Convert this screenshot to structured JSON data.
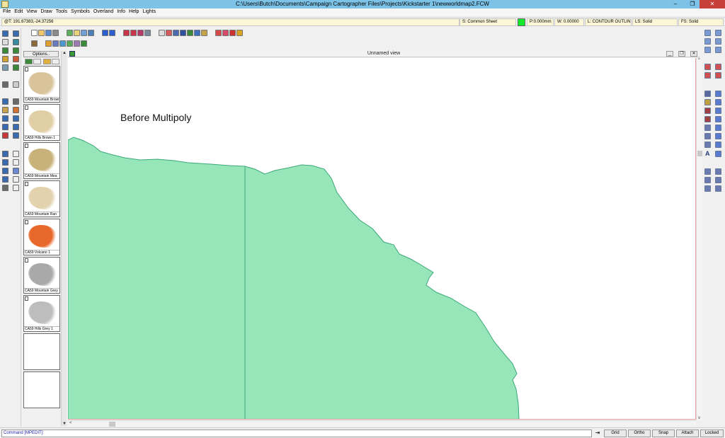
{
  "window": {
    "title": "C:\\Users\\Butch\\Documents\\Campaign Cartographer Files\\Projects\\Kickstarter 1\\newworldmap2.FCW",
    "minimize": "–",
    "maximize": "❐",
    "close": "✕"
  },
  "menu": [
    "File",
    "Edit",
    "View",
    "Draw",
    "Tools",
    "Symbols",
    "Overland",
    "Info",
    "Help",
    "Lights"
  ],
  "status": {
    "coords": "@T: 191.67383,-24.37256",
    "sheet": "S: Common Sheet",
    "pen": "P:0.000mm",
    "width": "W: 0.00000",
    "layer": "L: CONTOUR OUTLINE",
    "line_style": "LS: Solid",
    "fill_style": "FS: Solid",
    "color": "#13e92a"
  },
  "symbol_panel": {
    "options_label": "Options..",
    "symbols": [
      {
        "label": "CA59 Mountain Brown",
        "tint": "#d8c39a"
      },
      {
        "label": "CA59 Hills Brown 1",
        "tint": "#e0cfa5"
      },
      {
        "label": "CA59 Mountain Mea",
        "tint": "#c9b27a"
      },
      {
        "label": "CA59 Mountain Ran",
        "tint": "#e2d2ae"
      },
      {
        "label": "CA59 Volcano 1",
        "tint": "#e8672a"
      },
      {
        "label": "CA59 Mountain Grey",
        "tint": "#a9a9a9"
      },
      {
        "label": "CA59 Hills Grey 1",
        "tint": "#bdbdbd"
      }
    ]
  },
  "view": {
    "title": "Unnamed view",
    "map_label": "Before Multipoly",
    "fill_color": "#96e6b9",
    "stroke_color": "#3aa878"
  },
  "command": {
    "prompt": "Command [MPEDIT]:",
    "enter_icon": "enter-arrow-icon"
  },
  "mode_buttons": [
    "Grid",
    "Ortho",
    "Snap",
    "Attach",
    "Locked"
  ]
}
